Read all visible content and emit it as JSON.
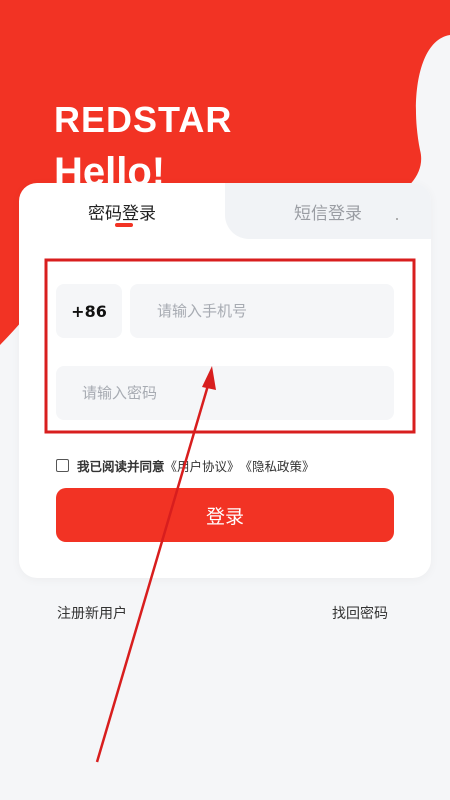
{
  "brand": {
    "logo_text": "REDSTAR",
    "greeting": "Hello!"
  },
  "tabs": [
    {
      "label": "密码登录",
      "active": true
    },
    {
      "label": "短信登录",
      "active": false
    }
  ],
  "form": {
    "country_code": "+86",
    "phone_placeholder": "请输入手机号",
    "password_placeholder": "请输入密码",
    "agreement_prefix": "我已阅读并同意",
    "user_agreement": "《用户协议》",
    "privacy_policy": "《隐私政策》",
    "login_label": "登录"
  },
  "footer": {
    "register_label": "注册新用户",
    "forgot_label": "找回密码"
  },
  "colors": {
    "brand_red": "#f23324",
    "annotation_red": "#d81e1e",
    "background": "#f5f6f8"
  },
  "icons": {
    "checkbox": "unchecked-checkbox-icon"
  }
}
